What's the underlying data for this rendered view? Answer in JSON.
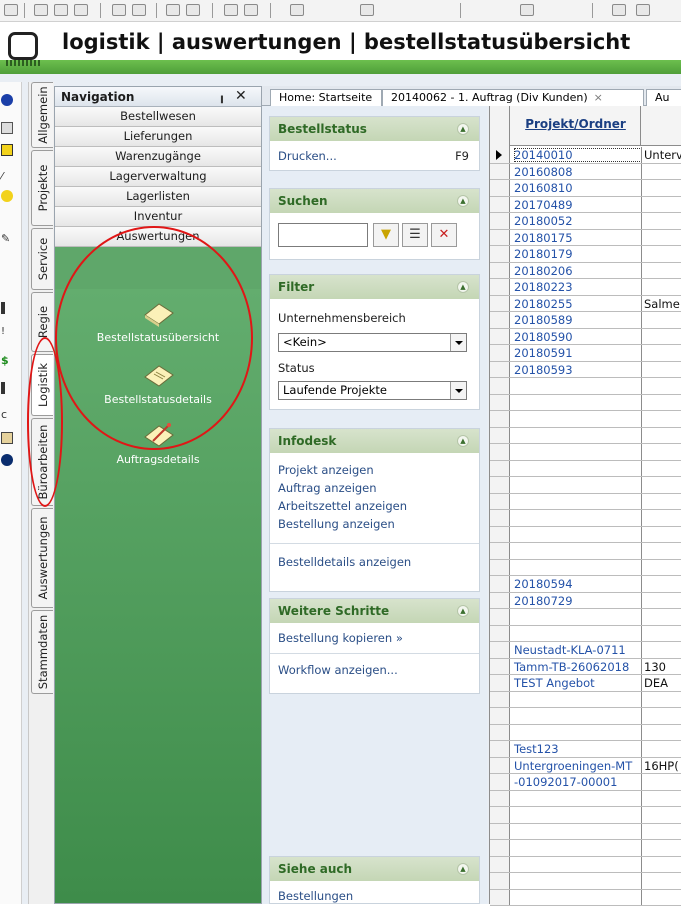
{
  "title": "logistik | auswertungen | bestellstatusübersicht",
  "colors": {
    "accent_green": "#4f9e39",
    "nav_green": "#3e8c4a",
    "annotation_red": "#e01616",
    "link_blue": "#2452a8"
  },
  "vertical_tabs": [
    "Allgemein",
    "Projekte",
    "Service",
    "Regie",
    "Logistik",
    "Büroarbeiten",
    "Auswertungen",
    "Stammdaten"
  ],
  "navigation": {
    "title": "Navigation",
    "pin_icon": "pin-icon",
    "close_icon": "close-icon",
    "menu": [
      "Bestellwesen",
      "Lieferungen",
      "Warenzugänge",
      "Lagerverwaltung",
      "Lagerlisten",
      "Inventur",
      "Auswertungen"
    ],
    "items": [
      {
        "label": "Bestellstatusübersicht",
        "icon": "report-icon"
      },
      {
        "label": "Bestellstatusdetails",
        "icon": "report-details-icon"
      },
      {
        "label": "Auftragsdetails",
        "icon": "order-details-icon"
      }
    ]
  },
  "doc_tabs": [
    {
      "label": "Home: Startseite"
    },
    {
      "label": "20140062 - 1. Auftrag (Div Kunden)",
      "close": "×"
    },
    {
      "label": "Au"
    }
  ],
  "tasks": {
    "bestellstatus": {
      "title": "Bestellstatus",
      "print_label": "Drucken...",
      "print_key": "F9"
    },
    "suchen": {
      "title": "Suchen",
      "search_value": ""
    },
    "filter": {
      "title": "Filter",
      "unternehmen_label": "Unternehmensbereich",
      "unternehmen_value": "<Kein>",
      "status_label": "Status",
      "status_value": "Laufende Projekte"
    },
    "infodesk": {
      "title": "Infodesk",
      "links": [
        "Projekt anzeigen",
        "Auftrag anzeigen",
        "Arbeitszettel anzeigen",
        "Bestellung anzeigen"
      ],
      "link2": "Bestelldetails anzeigen"
    },
    "weitere": {
      "title": "Weitere Schritte",
      "link1": "Bestellung kopieren »",
      "link2": "Workflow anzeigen..."
    },
    "siehe": {
      "title": "Siehe auch",
      "link1": "Bestellungen"
    }
  },
  "grid": {
    "column1": "Projekt/Ordner",
    "rows": [
      {
        "c1": "20140010",
        "c2": "Unterv"
      },
      {
        "c1": "20160808",
        "c2": ""
      },
      {
        "c1": "20160810",
        "c2": ""
      },
      {
        "c1": "20170489",
        "c2": ""
      },
      {
        "c1": "20180052",
        "c2": ""
      },
      {
        "c1": "20180175",
        "c2": ""
      },
      {
        "c1": "20180179",
        "c2": ""
      },
      {
        "c1": "20180206",
        "c2": ""
      },
      {
        "c1": "20180223",
        "c2": ""
      },
      {
        "c1": "20180255",
        "c2": "Salme"
      },
      {
        "c1": "20180589",
        "c2": ""
      },
      {
        "c1": "20180590",
        "c2": ""
      },
      {
        "c1": "20180591",
        "c2": ""
      },
      {
        "c1": "20180593",
        "c2": ""
      },
      {
        "c1": "",
        "c2": ""
      },
      {
        "c1": "",
        "c2": ""
      },
      {
        "c1": "",
        "c2": ""
      },
      {
        "c1": "",
        "c2": ""
      },
      {
        "c1": "",
        "c2": ""
      },
      {
        "c1": "",
        "c2": ""
      },
      {
        "c1": "",
        "c2": ""
      },
      {
        "c1": "",
        "c2": ""
      },
      {
        "c1": "",
        "c2": ""
      },
      {
        "c1": "",
        "c2": ""
      },
      {
        "c1": "",
        "c2": ""
      },
      {
        "c1": "",
        "c2": ""
      },
      {
        "c1": "20180594",
        "c2": ""
      },
      {
        "c1": "20180729",
        "c2": ""
      },
      {
        "c1": "",
        "c2": ""
      },
      {
        "c1": "",
        "c2": ""
      },
      {
        "c1": "Neustadt-KLA-0711",
        "c2": ""
      },
      {
        "c1": "Tamm-TB-26062018",
        "c2": "130"
      },
      {
        "c1": "TEST Angebot",
        "c2": "DEA"
      },
      {
        "c1": "",
        "c2": ""
      },
      {
        "c1": "",
        "c2": ""
      },
      {
        "c1": "",
        "c2": ""
      },
      {
        "c1": "Test123",
        "c2": ""
      },
      {
        "c1": "Untergroeningen-MT",
        "c2": "16HP("
      },
      {
        "c1": "-01092017-00001",
        "c2": ""
      },
      {
        "c1": "",
        "c2": ""
      },
      {
        "c1": "",
        "c2": ""
      },
      {
        "c1": "",
        "c2": ""
      },
      {
        "c1": "",
        "c2": ""
      },
      {
        "c1": "",
        "c2": ""
      },
      {
        "c1": "",
        "c2": ""
      },
      {
        "c1": "",
        "c2": ""
      }
    ]
  }
}
